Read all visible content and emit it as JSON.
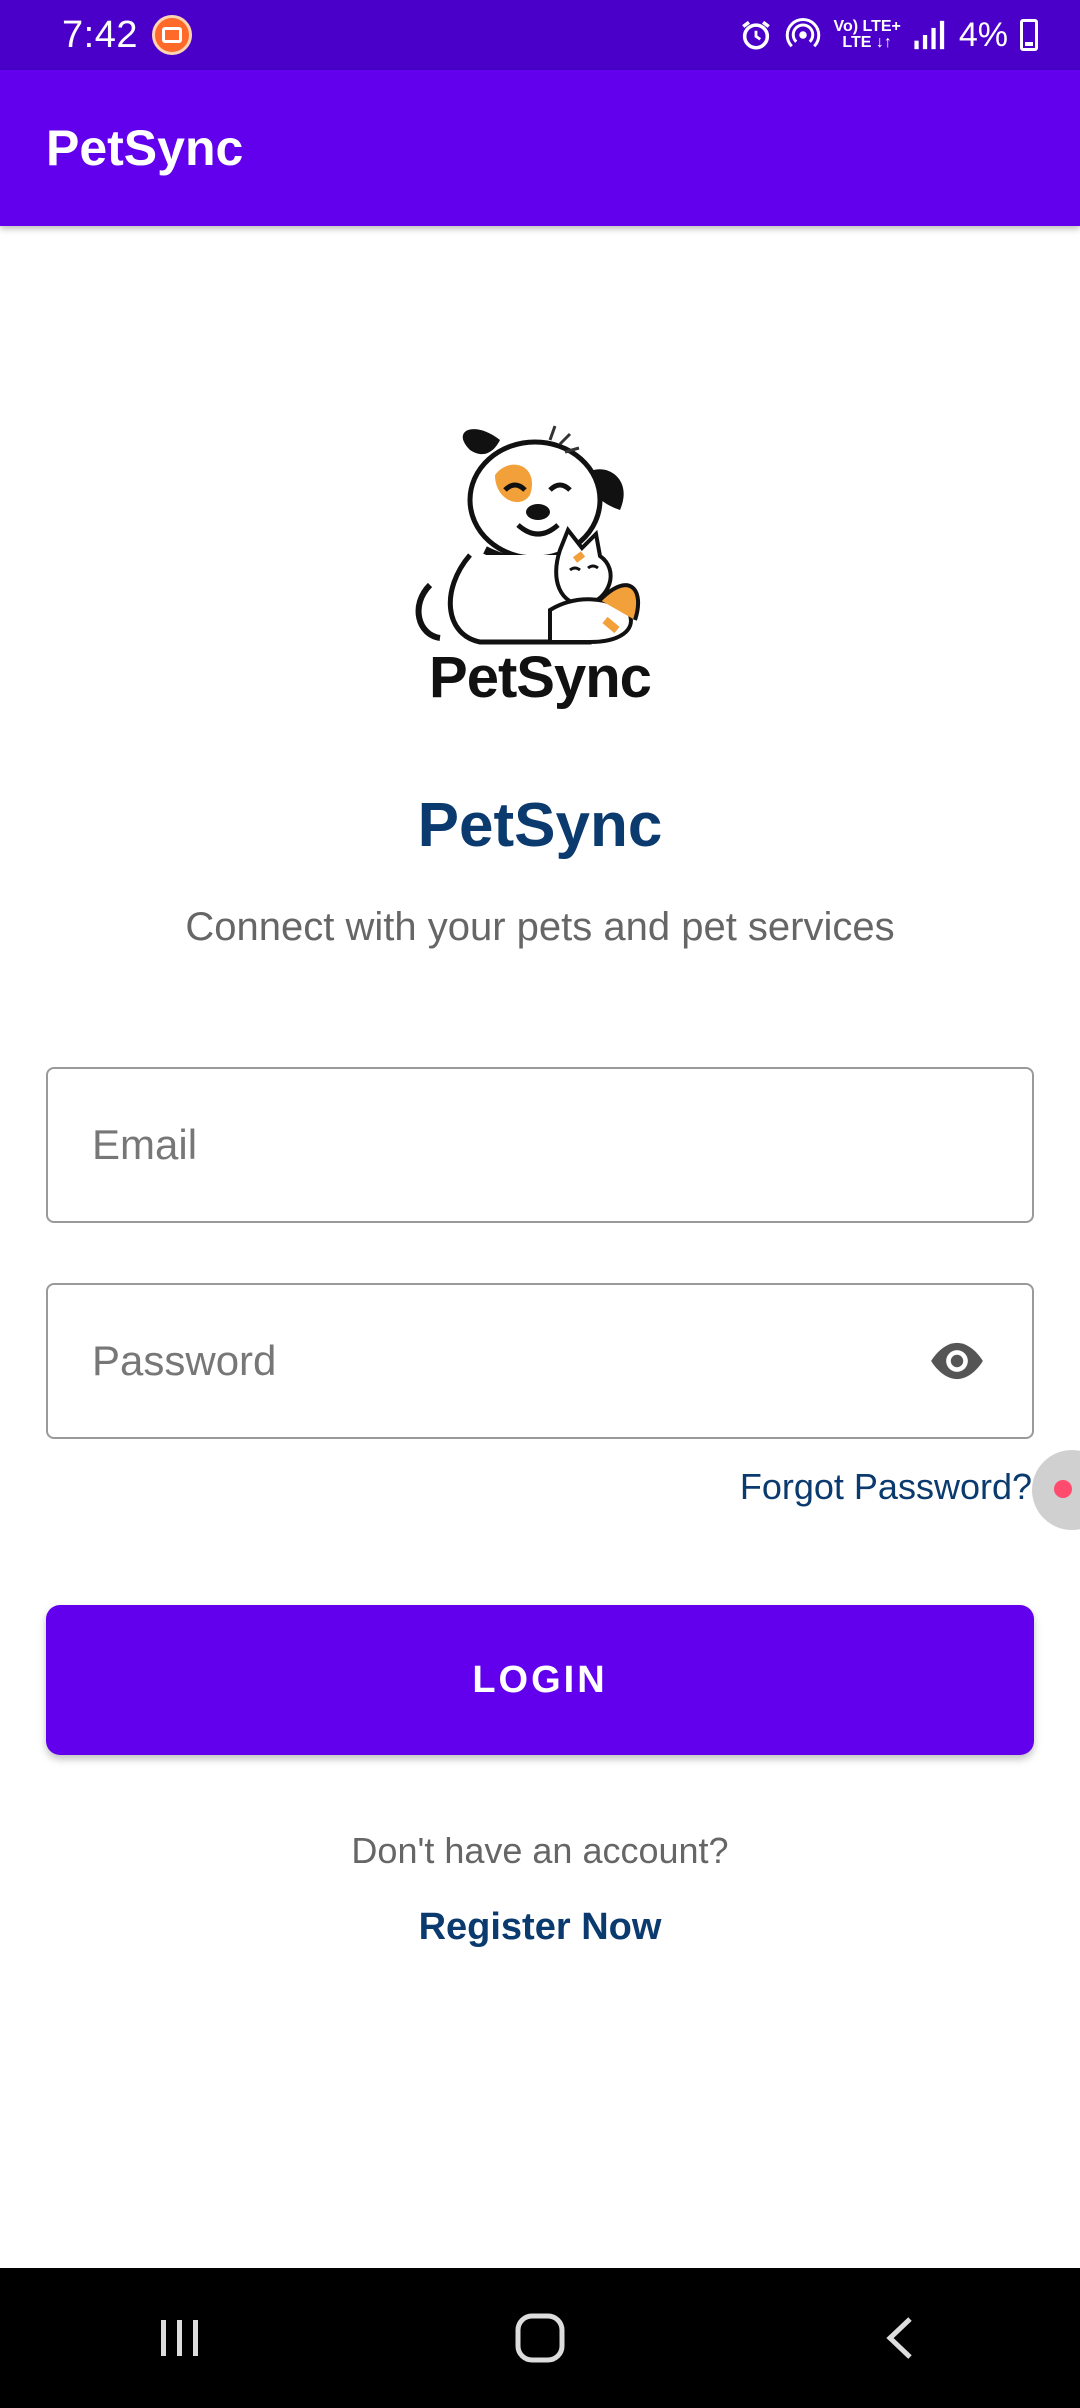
{
  "status_bar": {
    "time": "7:42",
    "battery": "4%",
    "lte_top": "Vo) LTE+",
    "lte_bottom": "LTE ↓↑"
  },
  "app_bar": {
    "title": "PetSync"
  },
  "logo": {
    "text": "PetSync"
  },
  "brand": {
    "title": "PetSync",
    "tagline": "Connect with your pets and pet services"
  },
  "form": {
    "email_placeholder": "Email",
    "password_placeholder": "Password",
    "forgot_label": "Forgot Password?",
    "login_label": "LOGIN"
  },
  "footer": {
    "no_account": "Don't have an account?",
    "register_label": "Register Now"
  },
  "icons": {
    "alarm": "alarm-icon",
    "hotspot": "hotspot-icon",
    "signal": "signal-icon",
    "battery": "battery-icon",
    "eye": "eye-icon",
    "recents": "recents-icon",
    "home": "home-icon",
    "back": "back-icon"
  },
  "colors": {
    "status_bar": "#4a00c9",
    "primary": "#6200ee",
    "brand_text": "#0b3a6e"
  }
}
